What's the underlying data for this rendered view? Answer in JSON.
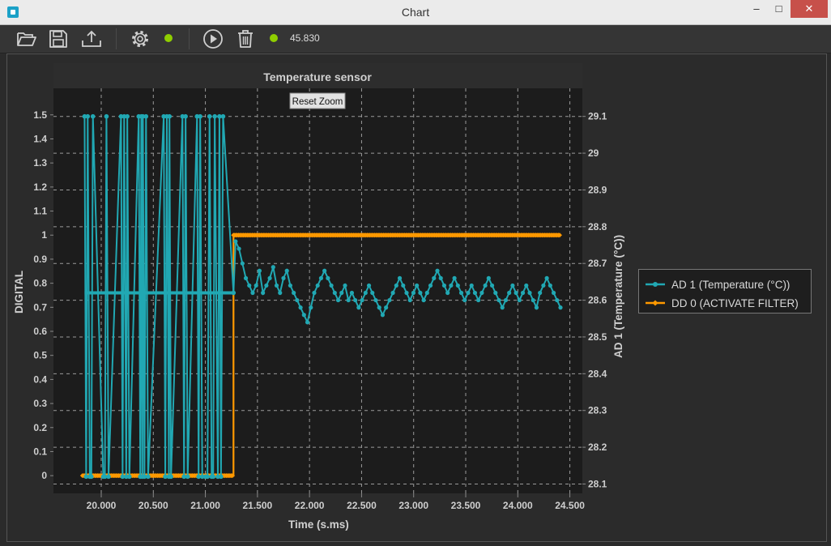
{
  "window": {
    "title": "Chart",
    "controls": {
      "minimize": "–",
      "maximize": "□",
      "close": "✕"
    }
  },
  "toolbar": {
    "buttons": [
      {
        "id": "open",
        "icon": "folder-open-icon"
      },
      {
        "id": "save",
        "icon": "floppy-disk-icon"
      },
      {
        "id": "export",
        "icon": "upload-icon"
      },
      {
        "id": "settings",
        "icon": "gear-icon"
      },
      {
        "id": "play",
        "icon": "play-circle-icon"
      },
      {
        "id": "delete",
        "icon": "trash-icon"
      }
    ],
    "status_dot_color": "#8fce00",
    "counter": "45.830"
  },
  "colors": {
    "series_ad1": "#21a8b3",
    "series_dd0": "#ff9900",
    "plot_bg": "#1c1c1c",
    "grid": "#9a9a9a"
  },
  "chart_data": {
    "type": "line",
    "title": "Temperature sensor",
    "xlabel": "Time (s.ms)",
    "ylabel_left": "DIGITAL",
    "ylabel_right": "AD 1 (Temperature (°C))",
    "xlim": [
      19.65,
      24.55
    ],
    "ylim_left": [
      -0.05,
      1.57
    ],
    "ylim_right": [
      28.09,
      29.15
    ],
    "x_ticks": [
      "20.000",
      "20.500",
      "21.000",
      "21.500",
      "22.000",
      "22.500",
      "23.000",
      "23.500",
      "24.000",
      "24.500"
    ],
    "y_left_ticks": [
      "0",
      "0.1",
      "0.2",
      "0.3",
      "0.4",
      "0.5",
      "0.6",
      "0.7",
      "0.8",
      "0.9",
      "1",
      "1.1",
      "1.2",
      "1.3",
      "1.4",
      "1.5"
    ],
    "y_right_ticks": [
      "28.1",
      "28.2",
      "28.3",
      "28.4",
      "28.5",
      "28.6",
      "28.7",
      "28.8",
      "28.9",
      "29",
      "29.1"
    ],
    "grid": true,
    "legend_position": "right",
    "reset_zoom_label": "Reset Zoom",
    "series": [
      {
        "name": "AD 1 (Temperature (°C))",
        "axis": "right",
        "x": [
          19.84,
          19.855,
          19.87,
          19.89,
          19.905,
          19.92,
          20.02,
          20.035,
          20.05,
          20.07,
          20.19,
          20.205,
          20.22,
          20.24,
          20.25,
          20.27,
          20.36,
          20.375,
          20.385,
          20.395,
          20.4,
          20.415,
          20.43,
          20.45,
          20.6,
          20.615,
          20.63,
          20.65,
          20.655,
          20.67,
          20.78,
          20.795,
          20.81,
          20.83,
          20.92,
          20.935,
          20.95,
          20.97,
          21.0,
          21.02,
          21.04,
          21.06,
          21.075,
          21.09,
          21.12,
          21.135,
          21.15,
          21.17,
          21.27
        ],
        "y": [
          29.1,
          28.12,
          29.1,
          28.12,
          28.12,
          29.1,
          28.12,
          28.12,
          29.1,
          28.12,
          29.1,
          28.12,
          29.1,
          28.12,
          29.1,
          28.12,
          29.1,
          28.12,
          29.1,
          28.12,
          29.1,
          28.12,
          29.1,
          28.12,
          29.1,
          28.12,
          29.1,
          28.12,
          29.1,
          28.12,
          29.1,
          28.12,
          29.1,
          28.12,
          29.1,
          28.12,
          29.1,
          28.12,
          28.12,
          28.12,
          29.1,
          28.12,
          28.12,
          29.1,
          28.12,
          29.1,
          28.12,
          29.1,
          28.62
        ],
        "y_held": 28.62,
        "tail_x_start": 21.29,
        "tail_x_end": 24.41,
        "tail_y": [
          28.76,
          28.74,
          28.7,
          28.66,
          28.64,
          28.62,
          28.64,
          28.68,
          28.62,
          28.64,
          28.66,
          28.69,
          28.64,
          28.62,
          28.66,
          28.68,
          28.64,
          28.62,
          28.6,
          28.58,
          28.56,
          28.54,
          28.58,
          28.62,
          28.64,
          28.66,
          28.68,
          28.66,
          28.64,
          28.62,
          28.6,
          28.62,
          28.64,
          28.6,
          28.62,
          28.6,
          28.58,
          28.6,
          28.62,
          28.64,
          28.62,
          28.6,
          28.58,
          28.56,
          28.58,
          28.6,
          28.62,
          28.64,
          28.66,
          28.64,
          28.62,
          28.6,
          28.62,
          28.64,
          28.62,
          28.6,
          28.62,
          28.64,
          28.66,
          28.68,
          28.66,
          28.64,
          28.62,
          28.64,
          28.66,
          28.64,
          28.62,
          28.6,
          28.62,
          28.64,
          28.62,
          28.6,
          28.62,
          28.64,
          28.66,
          28.64,
          28.62,
          28.6,
          28.58,
          28.6,
          28.62,
          28.64,
          28.62,
          28.6,
          28.62,
          28.64,
          28.62,
          28.6,
          28.58,
          28.62,
          28.64,
          28.66,
          28.64,
          28.62,
          28.6,
          28.58
        ]
      },
      {
        "name": "DD 0 (ACTIVATE FILTER)",
        "axis": "left",
        "x": [
          19.82,
          21.27,
          21.27,
          24.41
        ],
        "y": [
          0,
          0,
          1,
          1
        ]
      }
    ]
  }
}
